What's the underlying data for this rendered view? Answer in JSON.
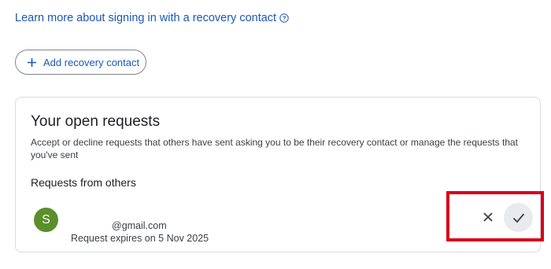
{
  "learn_more": {
    "text": "Learn more about signing in with a recovery contact",
    "icon": "help-circle-icon"
  },
  "add_button": {
    "label": "Add recovery contact",
    "icon": "plus-icon"
  },
  "open_requests": {
    "title": "Your open requests",
    "description": "Accept or decline requests that others have sent asking you to be their recovery contact or manage the requests that you've sent",
    "section_heading": "Requests from others",
    "requests": [
      {
        "avatar_letter": "S",
        "avatar_color": "#5a8f2b",
        "email": "@gmail.com",
        "expiry": "Request expires on 5 Nov 2025",
        "decline_icon": "close-icon",
        "accept_icon": "check-icon"
      }
    ]
  },
  "colors": {
    "link": "#1a57b8",
    "highlight": "#d9001b",
    "accept_button_bg": "#e8eaed"
  }
}
